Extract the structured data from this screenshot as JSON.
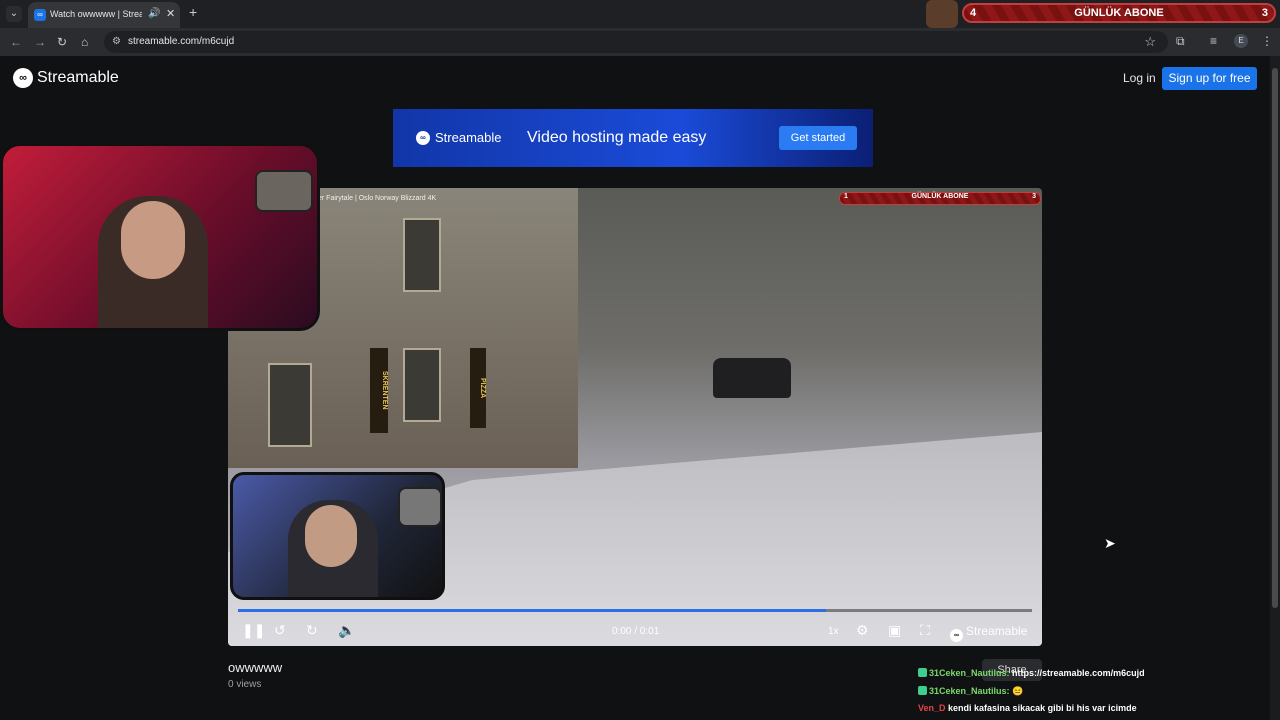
{
  "browser": {
    "tab_title": "Watch owwwww | Streamable",
    "tab_favicon": "∞",
    "tab_audio_icon": "🔊",
    "tab_close": "✕",
    "new_tab": "+",
    "url": "streamable.com/m6cujd",
    "star": "☆",
    "profile_initial": "E"
  },
  "stream_overlay": {
    "left_count": "4",
    "title": "GÜNLÜK ABONE",
    "right_count": "3"
  },
  "site": {
    "logo_text": "Streamable",
    "login_label": "Log in",
    "signup_label": "Sign up for free"
  },
  "ad": {
    "brand": "Streamable",
    "tagline": "Video hosting made easy",
    "cta": "Get started"
  },
  "video": {
    "caption": "er Fairytale | Oslo Norway Blizzard 4K",
    "overlay": {
      "left": "1",
      "title": "GÜNLÜK ABONE",
      "right": "3"
    },
    "progress": 0.74,
    "time": "0:00 / 0:01",
    "speed": "1x",
    "brand": "Streamable",
    "shop_sign_1": "SKRENTEN",
    "shop_sign_2": "PIZZA"
  },
  "page": {
    "video_title": "owwwww",
    "views": "0 views",
    "share_label": "Share"
  },
  "chat": [
    {
      "user": "31Ceken_Nautilus:",
      "message": "https://streamable.com/m6cujd"
    },
    {
      "user": "31Ceken_Nautilus:",
      "message": "😐"
    },
    {
      "user": "Ven_D",
      "message": "kendi kafasina sikacak gibi bi his var icimde"
    }
  ]
}
